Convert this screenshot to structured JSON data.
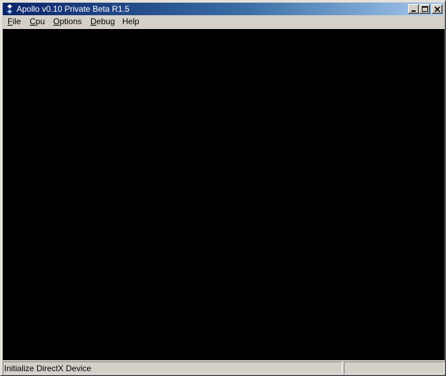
{
  "window": {
    "title": "Apollo v0.10 Private Beta R1.5",
    "title_icon": "n64-logo-icon"
  },
  "caption_buttons": {
    "minimize": "minimize-icon",
    "maximize": "maximize-icon",
    "close": "close-icon"
  },
  "menu": {
    "items": [
      {
        "mnemonic": "F",
        "rest": "ile"
      },
      {
        "mnemonic": "C",
        "rest": "pu"
      },
      {
        "mnemonic": "O",
        "rest": "ptions"
      },
      {
        "mnemonic": "D",
        "rest": "ebug"
      },
      {
        "mnemonic": "",
        "rest": "Help"
      }
    ]
  },
  "status": {
    "message": "Initialize DirectX Device",
    "secondary": ""
  },
  "colors": {
    "title_start": "#0a246a",
    "title_end": "#a6caf0",
    "chrome": "#d4d0c8",
    "canvas": "#000000"
  }
}
